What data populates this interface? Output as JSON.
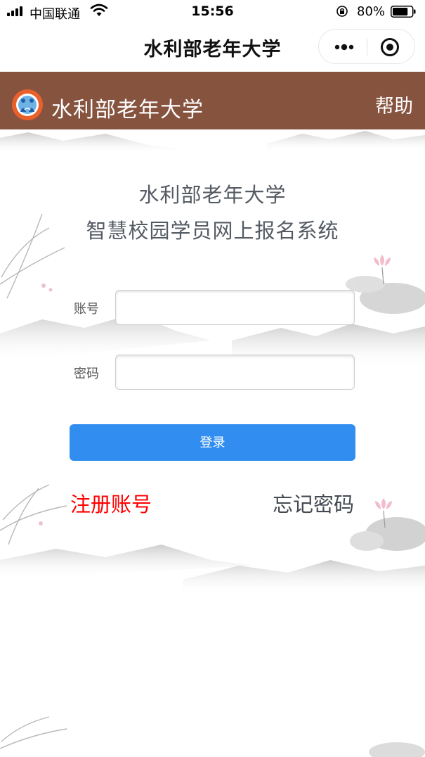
{
  "status_bar": {
    "carrier": "中国联通",
    "time": "15:56",
    "battery_percent": "80%",
    "battery_level": 0.8
  },
  "nav_bar": {
    "title": "水利部老年大学",
    "more_icon": "more-dots-icon",
    "close_icon": "close-circle-icon"
  },
  "header": {
    "title": "水利部老年大学",
    "help": "帮助",
    "background": "#86533f"
  },
  "main": {
    "title_line1": "水利部老年大学",
    "title_line2": "智慧校园学员网上报名系统",
    "account_label": "账号",
    "account_value": "",
    "password_label": "密码",
    "password_value": "",
    "login_label": "登录",
    "register_label": "注册账号",
    "forgot_label": "忘记密码"
  },
  "colors": {
    "login_button": "#318ef0",
    "register_link": "#ff0000",
    "title_text": "#555b63"
  }
}
